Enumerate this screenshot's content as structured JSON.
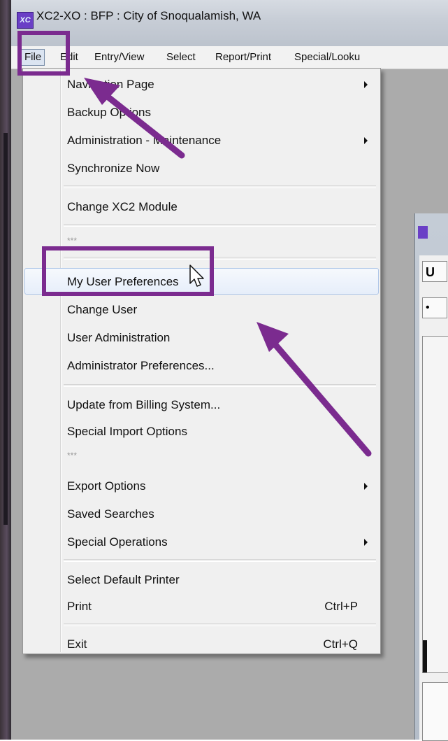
{
  "window": {
    "title": "XC2-XO  :  BFP  :  City of Snoqualamish, WA",
    "icon_text": "XC"
  },
  "menubar": [
    {
      "label": "File"
    },
    {
      "label": "Edit"
    },
    {
      "label": "Entry/View"
    },
    {
      "label": "Select"
    },
    {
      "label": "Report/Print"
    },
    {
      "label": "Special/Looku"
    }
  ],
  "file_menu": {
    "items": [
      {
        "label": "Navigation Page",
        "submenu": true
      },
      {
        "label": "Backup Options"
      },
      {
        "label": "Administration - Maintenance",
        "submenu": true
      },
      {
        "label": "Synchronize Now"
      },
      {
        "label": "Change XC2 Module"
      },
      {
        "label": "***"
      },
      {
        "label": "My User Preferences",
        "hovered": true
      },
      {
        "label": "Change User"
      },
      {
        "label": "User Administration"
      },
      {
        "label": "Administrator Preferences..."
      },
      {
        "label": "Update from Billing System..."
      },
      {
        "label": "Special Import Options"
      },
      {
        "label": "***"
      },
      {
        "label": "Export Options",
        "submenu": true
      },
      {
        "label": "Saved Searches"
      },
      {
        "label": "Special Operations",
        "submenu": true
      },
      {
        "label": "Select Default Printer"
      },
      {
        "label": "Print",
        "shortcut": "Ctrl+P"
      },
      {
        "label": "Exit",
        "shortcut": "Ctrl+Q"
      }
    ]
  },
  "child_window": {
    "button_label": "U",
    "dot_label": "•"
  },
  "colors": {
    "annotation": "#7b2b8f",
    "menu_bg": "#f0f0f0",
    "hover_border": "#aec6e8"
  }
}
